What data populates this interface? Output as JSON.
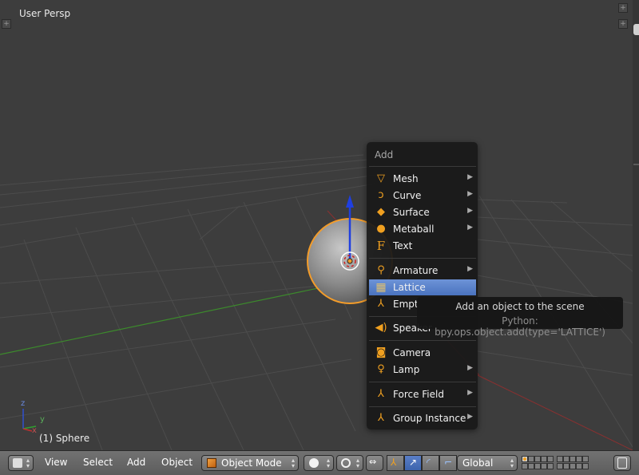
{
  "viewport": {
    "view_name": "User Persp",
    "object_name": "(1) Sphere",
    "axis_labels": {
      "x": "x",
      "y": "y",
      "z": "z"
    }
  },
  "add_menu": {
    "title": "Add",
    "items": [
      {
        "label": "Mesh",
        "icon": "mesh-icon",
        "submenu": true
      },
      {
        "label": "Curve",
        "icon": "curve-icon",
        "submenu": true
      },
      {
        "label": "Surface",
        "icon": "surface-icon",
        "submenu": true
      },
      {
        "label": "Metaball",
        "icon": "metaball-icon",
        "submenu": true
      },
      {
        "label": "Text",
        "icon": "text-icon",
        "submenu": false
      },
      {
        "label": "Armature",
        "icon": "armature-icon",
        "submenu": true
      },
      {
        "label": "Lattice",
        "icon": "lattice-icon",
        "submenu": false,
        "highlighted": true
      },
      {
        "label": "Empt",
        "icon": "empty-icon",
        "submenu": true
      },
      {
        "label": "Speaker",
        "icon": "speaker-icon",
        "submenu": false
      },
      {
        "label": "Camera",
        "icon": "camera-icon",
        "submenu": false
      },
      {
        "label": "Lamp",
        "icon": "lamp-icon",
        "submenu": true
      },
      {
        "label": "Force Field",
        "icon": "force-field-icon",
        "submenu": true
      },
      {
        "label": "Group Instance",
        "icon": "group-instance-icon",
        "submenu": true
      }
    ]
  },
  "tooltip": {
    "title": "Add an object to the scene",
    "python": "Python: bpy.ops.object.add(type='LATTICE')"
  },
  "header": {
    "menus": {
      "view": "View",
      "select": "Select",
      "add": "Add",
      "object": "Object"
    },
    "mode": "Object Mode",
    "orientation": "Global"
  },
  "colors": {
    "highlight": "#5b83cc",
    "accent_orange": "#f0a020",
    "selection_outline": "#f39c2a"
  }
}
